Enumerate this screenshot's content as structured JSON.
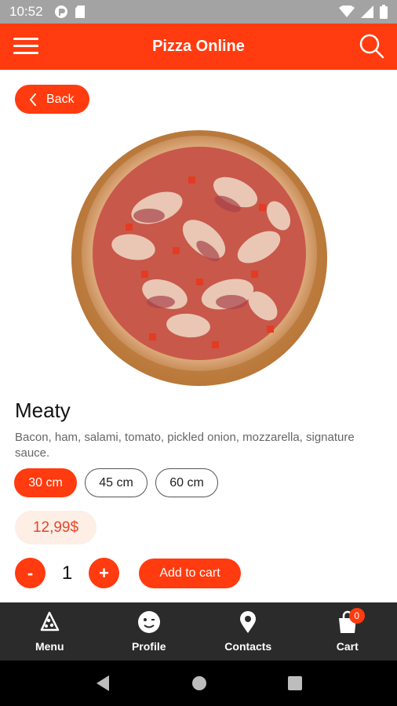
{
  "status_bar": {
    "time": "10:52"
  },
  "app_bar": {
    "title": "Pizza Online"
  },
  "back": {
    "label": "Back"
  },
  "product": {
    "name": "Meaty",
    "description": "Bacon, ham, salami, tomato, pickled onion, mozzarella, signature sauce.",
    "sizes": [
      "30 cm",
      "45 cm",
      "60 cm"
    ],
    "selected_size": "30 cm",
    "price": "12,99$",
    "quantity": "1"
  },
  "buttons": {
    "minus": "-",
    "plus": "+",
    "add_to_cart": "Add to cart"
  },
  "nav": {
    "items": [
      {
        "label": "Menu",
        "icon": "pizza-slice-icon"
      },
      {
        "label": "Profile",
        "icon": "smiley-icon"
      },
      {
        "label": "Contacts",
        "icon": "location-pin-icon"
      },
      {
        "label": "Cart",
        "icon": "shopping-bag-icon"
      }
    ],
    "cart_count": "0"
  },
  "colors": {
    "accent": "#ff3b0f",
    "nav_bg": "#2b2b2b",
    "price_bg": "#fdeee6"
  }
}
